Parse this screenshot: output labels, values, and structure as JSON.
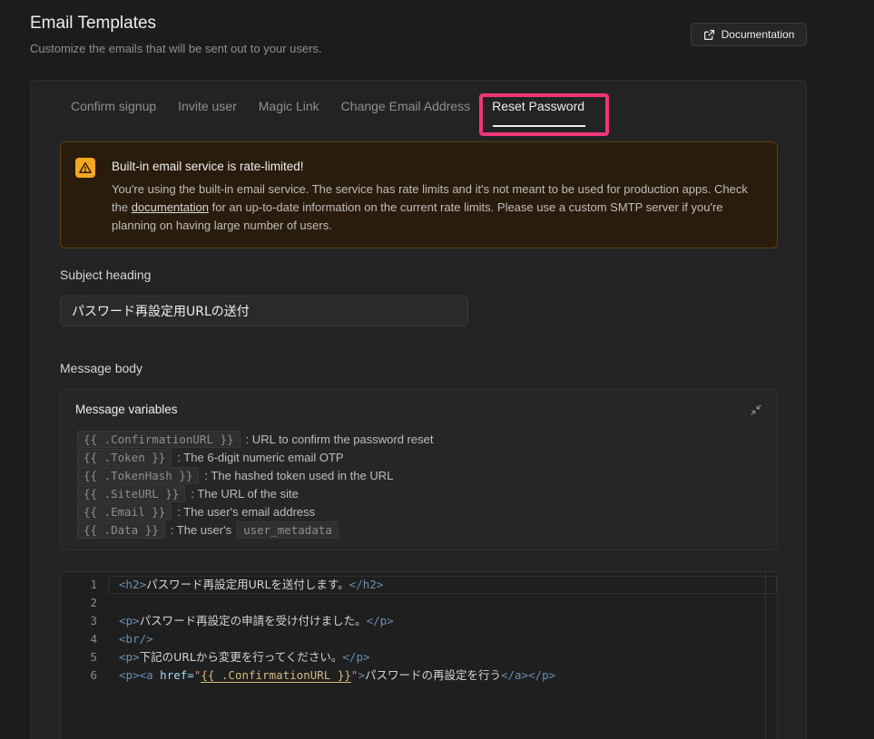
{
  "header": {
    "title": "Email Templates",
    "subtitle": "Customize the emails that will be sent out to your users.",
    "documentation_label": "Documentation"
  },
  "tabs": [
    {
      "label": "Confirm signup",
      "active": false
    },
    {
      "label": "Invite user",
      "active": false
    },
    {
      "label": "Magic Link",
      "active": false
    },
    {
      "label": "Change Email Address",
      "active": false
    },
    {
      "label": "Reset Password",
      "active": true
    }
  ],
  "warning": {
    "title": "Built-in email service is rate-limited!",
    "body_before": "You're using the built-in email service. The service has rate limits and it's not meant to be used for production apps. Check the ",
    "link": "documentation",
    "body_after": " for an up-to-date information on the current rate limits. Please use a custom SMTP server if you're planning on having large number of users."
  },
  "subject": {
    "label": "Subject heading",
    "value": "パスワード再設定用URLの送付"
  },
  "message": {
    "label": "Message body",
    "variables_title": "Message variables",
    "variables": [
      {
        "code": "{{ .ConfirmationURL }}",
        "desc": ": URL to confirm the password reset"
      },
      {
        "code": "{{ .Token }}",
        "desc": ": The 6-digit numeric email OTP"
      },
      {
        "code": "{{ .TokenHash }}",
        "desc": ": The hashed token used in the URL"
      },
      {
        "code": "{{ .SiteURL }}",
        "desc": ": The URL of the site"
      },
      {
        "code": "{{ .Email }}",
        "desc": ": The user's email address"
      },
      {
        "code": "{{ .Data }}",
        "desc": ": The user's",
        "extra_code": "user_metadata"
      }
    ]
  },
  "editor": {
    "line_numbers": [
      "1",
      "2",
      "3",
      "4",
      "5",
      "6"
    ],
    "l1": {
      "open": "<h2>",
      "text": "パスワード再設定用URLを送付します。",
      "close": "</h2>"
    },
    "l3": {
      "open": "<p>",
      "text": "パスワード再設定の申請を受け付けました。",
      "close": "</p>"
    },
    "l4": {
      "tag": "<br/>"
    },
    "l5": {
      "open": "<p>",
      "text": "下記のURLから変更を行ってください。",
      "close": "</p>"
    },
    "l6": {
      "p_open": "<p>",
      "a_open": "<a",
      "attr": " href=",
      "quote": "\"",
      "var": "{{ .ConfirmationURL }}",
      "gt": ">",
      "text": "パスワードの再設定を行う",
      "close": "</a></p>"
    }
  },
  "colors": {
    "background": "#1c1c1c",
    "highlight": "#f0357a",
    "warning_icon": "#f5a623"
  }
}
